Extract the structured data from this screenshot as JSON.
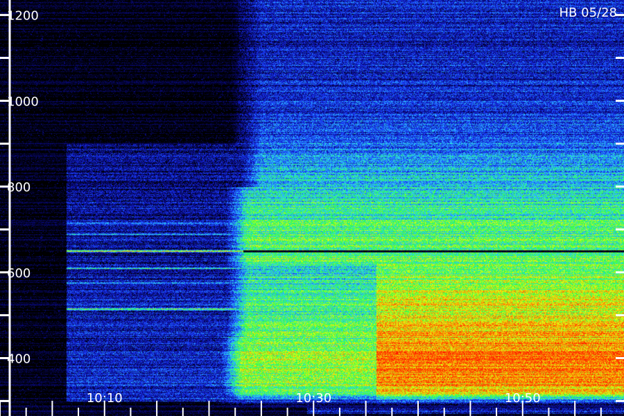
{
  "chart_data": {
    "type": "heatmap",
    "station_label": "HB 05/28",
    "y_tick_labels": [
      "1200",
      "1000",
      "800",
      "600",
      "400"
    ],
    "y_ticks": [
      1200,
      1000,
      800,
      600,
      400
    ],
    "y_range": [
      265,
      1235
    ],
    "x_tick_labels": [
      "10:10",
      "10:30",
      "10:50"
    ],
    "x_ticks": [
      10.1667,
      10.5,
      10.8333
    ],
    "x_range": [
      10.0,
      10.995
    ],
    "colormap": [
      "#000000",
      "#0a0a90",
      "#1a3cff",
      "#2fd0ff",
      "#27ff4a",
      "#e8ff10",
      "#ff7a00",
      "#ff1400"
    ],
    "onset_time": "10:22",
    "intensification_time": "10:36",
    "narrowband_lines": [
      {
        "freq": 715,
        "value": 0.35
      },
      {
        "freq": 690,
        "value": 0.45
      },
      {
        "freq": 650,
        "value": 0.75
      },
      {
        "freq": 610,
        "value": 0.55
      },
      {
        "freq": 575,
        "value": 0.45
      },
      {
        "freq": 515,
        "value": 0.7
      }
    ],
    "band_intensity_after_1036": [
      {
        "freq": 1060,
        "value": 0.2
      },
      {
        "freq": 900,
        "value": 0.3
      },
      {
        "freq": 800,
        "value": 0.45
      },
      {
        "freq": 700,
        "value": 0.55
      },
      {
        "freq": 600,
        "value": 0.62
      },
      {
        "freq": 500,
        "value": 0.7
      },
      {
        "freq": 400,
        "value": 0.85
      },
      {
        "freq": 320,
        "value": 0.75
      },
      {
        "freq": 290,
        "value": 0.05
      }
    ]
  }
}
